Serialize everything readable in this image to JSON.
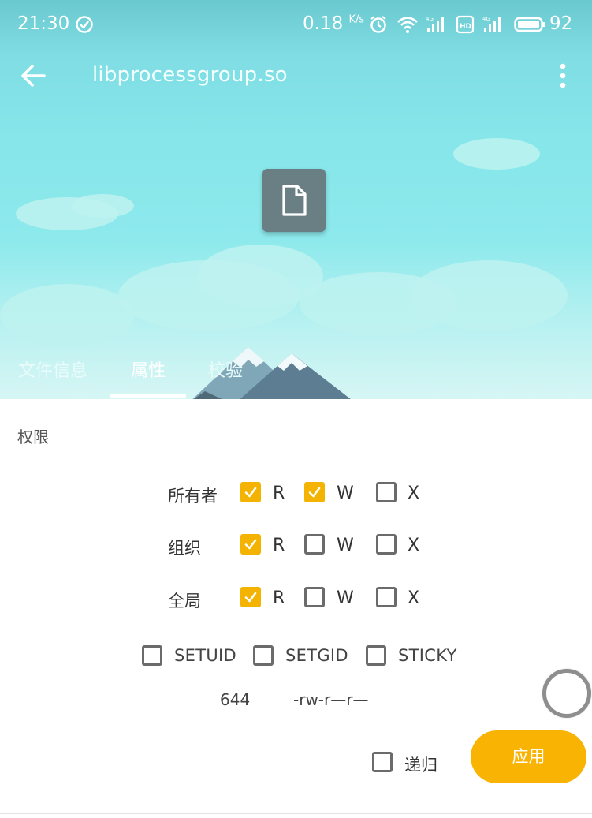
{
  "status_bar": {
    "time": "21:30",
    "net_speed": "0.18",
    "net_speed_unit": "K/s",
    "battery": "92",
    "icons": [
      "check-circle-icon",
      "alarm-icon",
      "wifi-icon",
      "signal-4g-icon",
      "hd-icon",
      "signal-4g-icon",
      "battery-icon"
    ]
  },
  "app_bar": {
    "title": "libprocessgroup.so",
    "back_icon": "arrow-left-icon",
    "more_icon": "more-vert-icon"
  },
  "file_icon": "file-icon",
  "tabs": [
    {
      "label": "文件信息",
      "active": false
    },
    {
      "label": "属性",
      "active": true
    },
    {
      "label": "校验",
      "active": false
    }
  ],
  "permissions": {
    "section_title": "权限",
    "rows": [
      {
        "label": "所有者",
        "r": true,
        "w": true,
        "x": false
      },
      {
        "label": "组织",
        "r": true,
        "w": false,
        "x": false
      },
      {
        "label": "全局",
        "r": true,
        "w": false,
        "x": false
      }
    ],
    "col_labels": {
      "r": "R",
      "w": "W",
      "x": "X"
    },
    "flags": [
      {
        "label": "SETUID",
        "checked": false
      },
      {
        "label": "SETGID",
        "checked": false
      },
      {
        "label": "STICKY",
        "checked": false
      }
    ],
    "octal": "644",
    "symbolic": "-rw-r—r—"
  },
  "recursive": {
    "label": "递归",
    "checked": false
  },
  "apply_label": "应用",
  "colors": {
    "accent": "#f8b303",
    "sky": "#8de9ec",
    "badge": "#6a7f84"
  }
}
